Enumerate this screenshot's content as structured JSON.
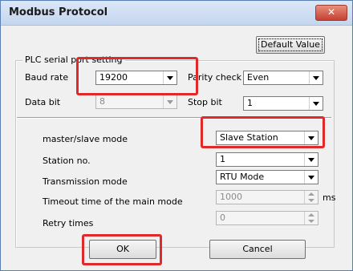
{
  "window": {
    "title": "Modbus Protocol",
    "close_glyph": "✕"
  },
  "toolbar": {
    "default_value_label": "Default Value"
  },
  "plc_serial": {
    "group_title": "PLC serial port setting",
    "baud_rate_label": "Baud rate",
    "baud_rate_value": "19200",
    "parity_label": "Parity check",
    "parity_value": "Even",
    "data_bit_label": "Data bit",
    "data_bit_value": "8",
    "stop_bit_label": "Stop bit",
    "stop_bit_value": "1"
  },
  "mode": {
    "master_slave_label": "master/slave mode",
    "master_slave_value": "Slave Station",
    "station_no_label": "Station no.",
    "station_no_value": "1",
    "transmission_label": "Transmission mode",
    "transmission_value": "RTU Mode",
    "timeout_label": "Timeout time of the main mode",
    "timeout_value": "1000",
    "timeout_unit": "ms",
    "retry_label": "Retry times",
    "retry_value": "0"
  },
  "footer": {
    "ok_label": "OK",
    "cancel_label": "Cancel"
  },
  "colors": {
    "highlight": "#e02a2a",
    "title_gradient_top": "#dbe7f7",
    "close_button": "#c4422f"
  }
}
